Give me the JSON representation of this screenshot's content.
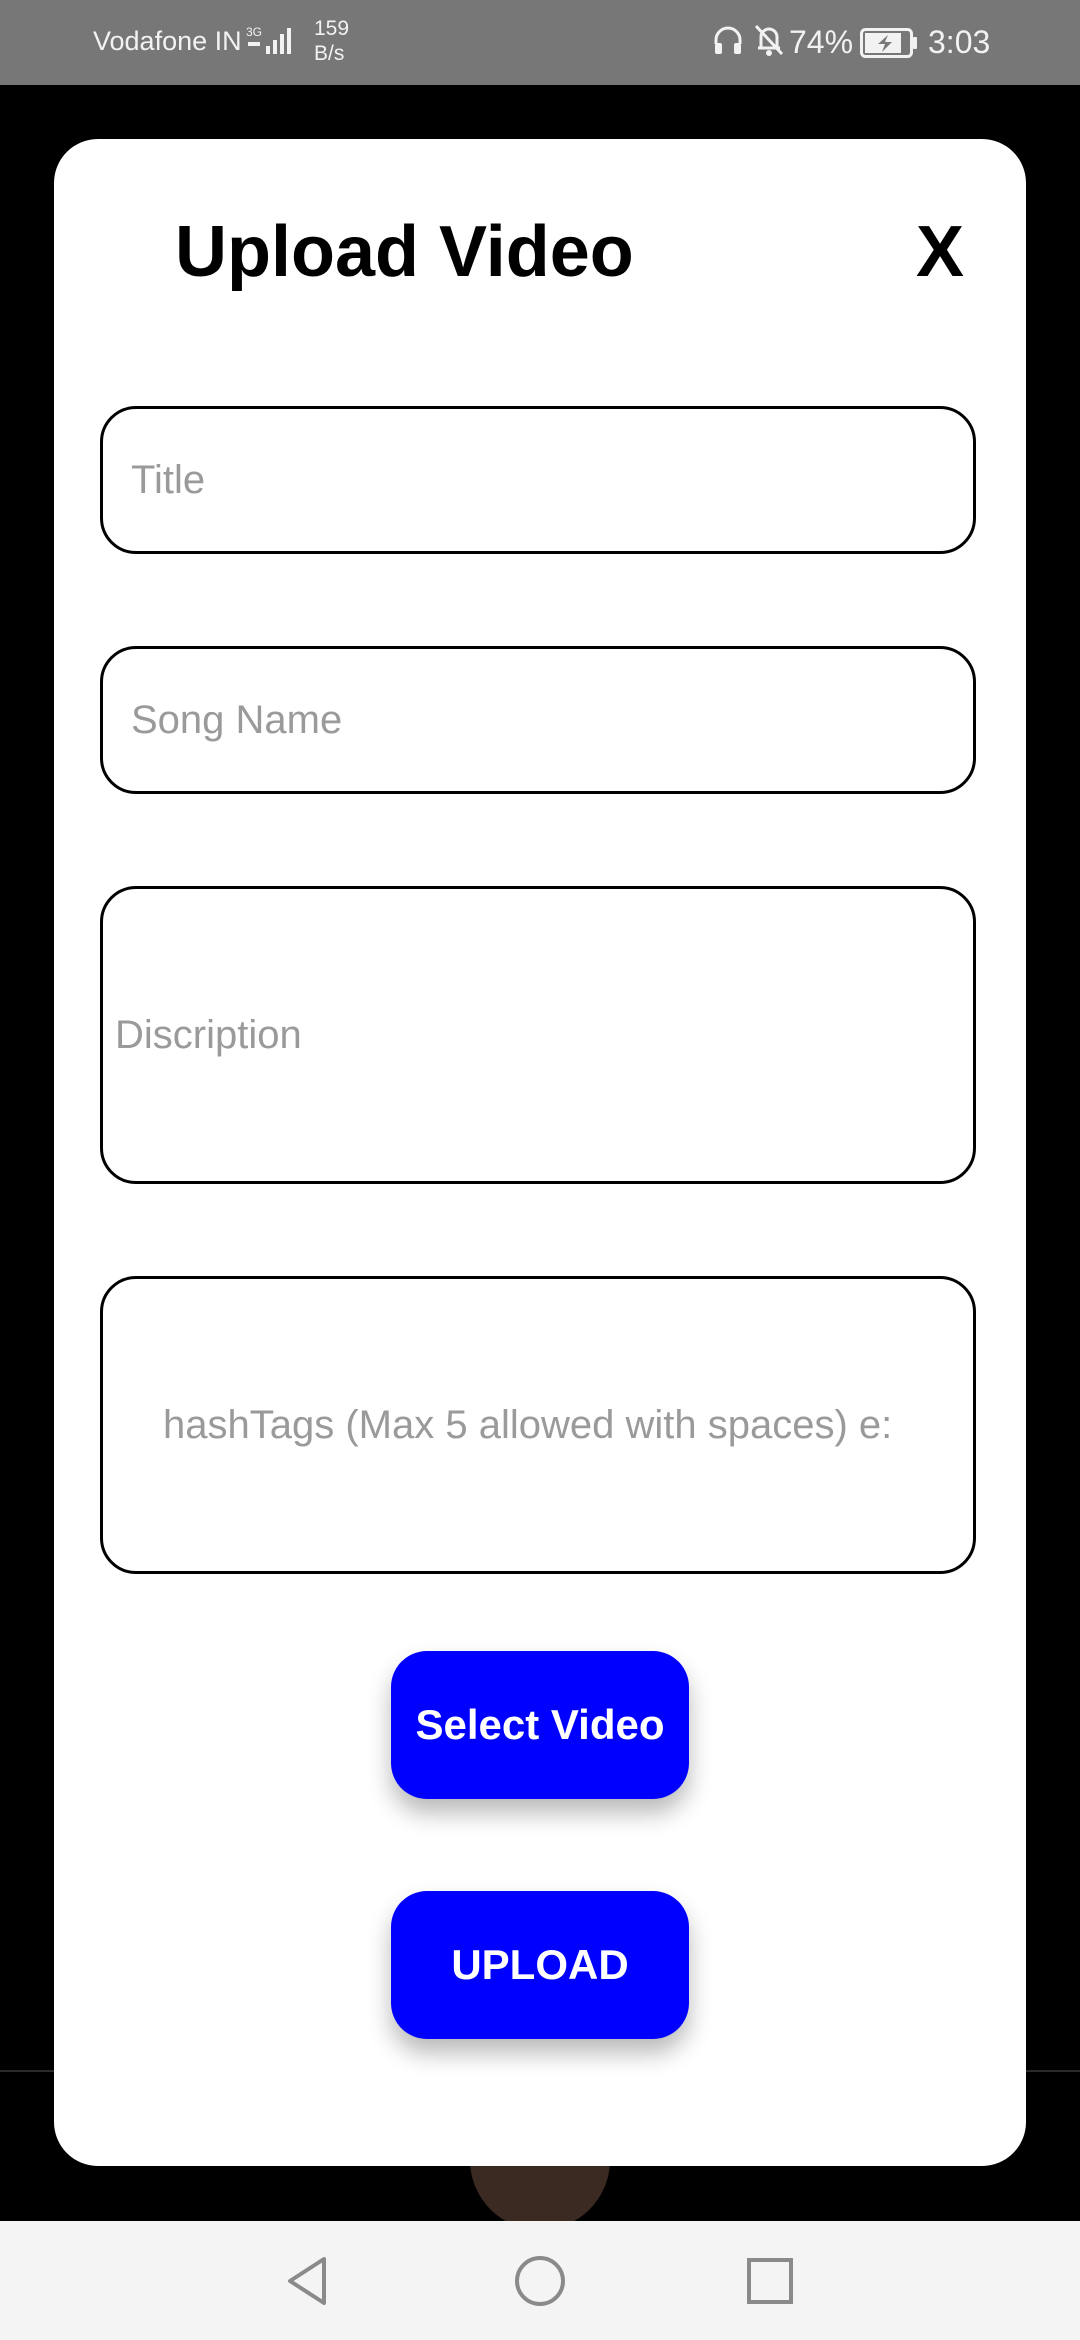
{
  "status_bar": {
    "carrier": "Vodafone IN",
    "network_type": "3G",
    "speed_value": "159",
    "speed_unit": "B/s",
    "battery": "74%",
    "time": "3:03"
  },
  "dialog": {
    "title": "Upload Video",
    "close_label": "X",
    "fields": {
      "title_placeholder": "Title",
      "song_placeholder": "Song Name",
      "description_placeholder": "Discription",
      "hashtags_placeholder": "hashTags (Max 5 allowed with spaces) e:"
    },
    "select_video_label": "Select Video",
    "upload_label": "UPLOAD"
  },
  "colors": {
    "accent": "#0000ff",
    "status_bar": "#777777",
    "placeholder": "#9a9a9a"
  },
  "icons": {
    "nav_back": "triangle-back-icon",
    "nav_home": "circle-home-icon",
    "nav_recent": "square-recent-icon"
  }
}
